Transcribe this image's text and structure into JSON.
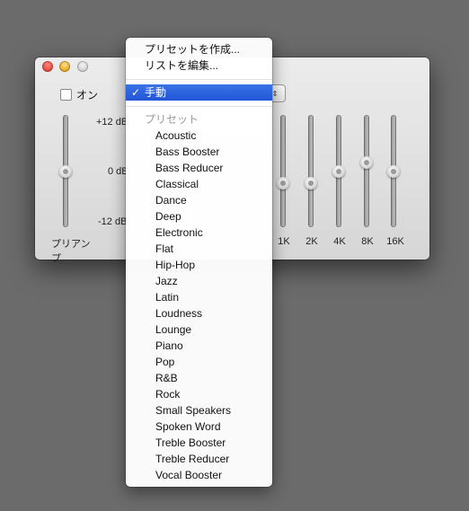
{
  "window": {
    "on_label": "オン",
    "db_top": "+12 dB",
    "db_mid": "0 dB",
    "db_bottom": "-12 dB",
    "preamp_label": "プリアンプ",
    "popup_arrow": "⇕"
  },
  "bands": [
    "1K",
    "2K",
    "4K",
    "8K",
    "16K"
  ],
  "slider_levels_db": {
    "preamp": 0,
    "1K": -3,
    "2K": -3,
    "4K": 0,
    "8K": 2,
    "16K": 0
  },
  "menu": {
    "create_preset": "プリセットを作成...",
    "edit_list": "リストを編集...",
    "checkmark": "✓",
    "selected": "手動",
    "preset_header": "プリセット",
    "presets": [
      "Acoustic",
      "Bass Booster",
      "Bass Reducer",
      "Classical",
      "Dance",
      "Deep",
      "Electronic",
      "Flat",
      "Hip-Hop",
      "Jazz",
      "Latin",
      "Loudness",
      "Lounge",
      "Piano",
      "Pop",
      "R&B",
      "Rock",
      "Small Speakers",
      "Spoken Word",
      "Treble Booster",
      "Treble Reducer",
      "Vocal Booster"
    ]
  },
  "colors": {
    "desktop": "#6b6b6b",
    "selection": "#2f66e0",
    "close": "#e0443b",
    "minimize": "#e3a51d"
  }
}
